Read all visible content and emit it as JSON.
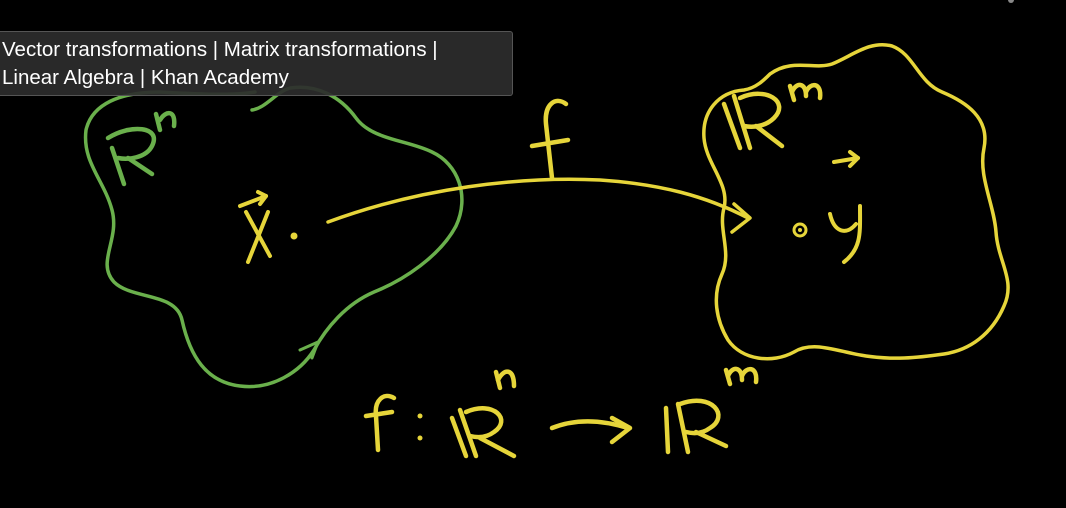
{
  "video": {
    "title_line_1": "Vector transformations | Matrix transformations |",
    "title_line_2": "Linear Algebra | Khan Academy"
  },
  "colors": {
    "background": "#000000",
    "domain_chalk": "#6ab04c",
    "codomain_chalk": "#e6d53a",
    "overlay_background": "#2d2d2d",
    "overlay_text": "#ffffff"
  }
}
